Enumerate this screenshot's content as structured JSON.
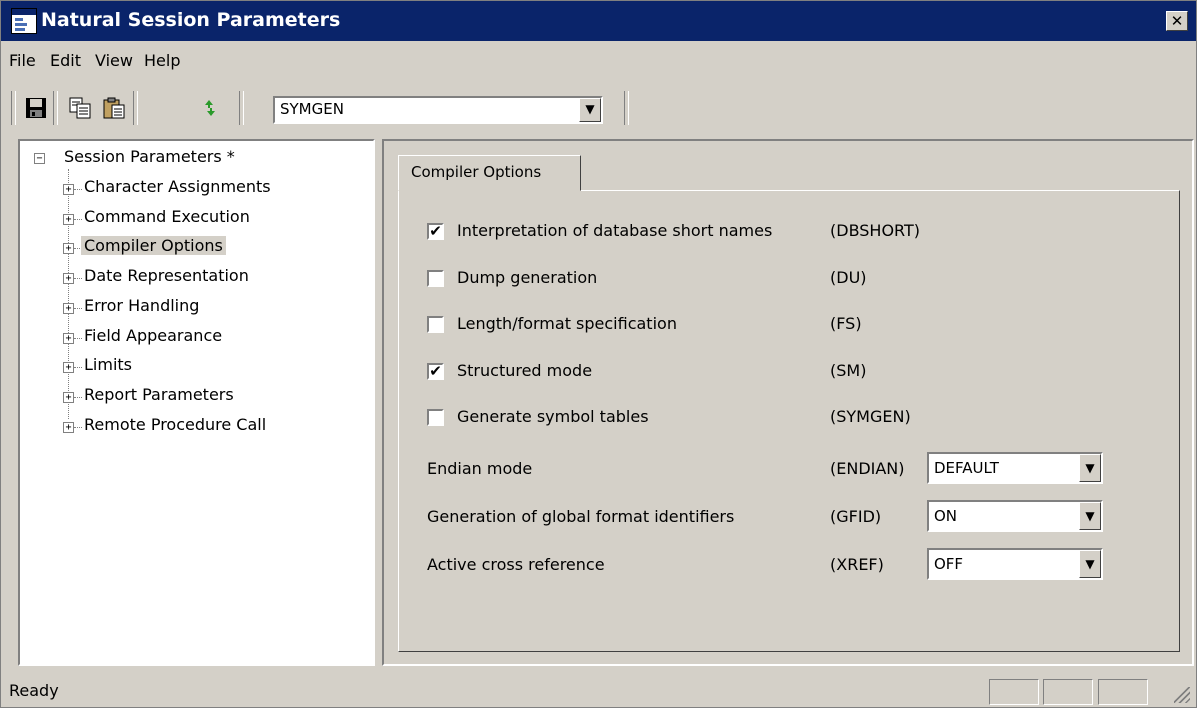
{
  "window": {
    "title": "Natural Session Parameters",
    "close_glyph": "✕"
  },
  "menu": [
    "File",
    "Edit",
    "View",
    "Help"
  ],
  "toolbar": {
    "buttons": [
      "save-icon",
      "copy-icon",
      "paste-icon",
      "refresh-icon"
    ],
    "combo_value": "SYMGEN"
  },
  "tree": {
    "root": "Session Parameters *",
    "items": [
      "Character Assignments",
      "Command Execution",
      "Compiler Options",
      "Date Representation",
      "Error Handling",
      "Field Appearance",
      "Limits",
      "Report Parameters",
      "Remote Procedure Call"
    ],
    "selected": "Compiler Options"
  },
  "panel": {
    "tab_label": "Compiler Options",
    "checkboxes": [
      {
        "label": "Interpretation of database short names",
        "code": "(DBSHORT)",
        "checked": true
      },
      {
        "label": "Dump generation",
        "code": "(DU)",
        "checked": false
      },
      {
        "label": "Length/format specification",
        "code": "(FS)",
        "checked": false
      },
      {
        "label": "Structured mode",
        "code": "(SM)",
        "checked": true
      },
      {
        "label": "Generate symbol tables",
        "code": "(SYMGEN)",
        "checked": false
      }
    ],
    "dropdowns": [
      {
        "label": "Endian mode",
        "code": "(ENDIAN)",
        "value": "DEFAULT"
      },
      {
        "label": "Generation of global format identifiers",
        "code": "(GFID)",
        "value": "ON"
      },
      {
        "label": "Active cross reference",
        "code": "(XREF)",
        "value": "OFF"
      }
    ]
  },
  "status": {
    "text": "Ready"
  }
}
